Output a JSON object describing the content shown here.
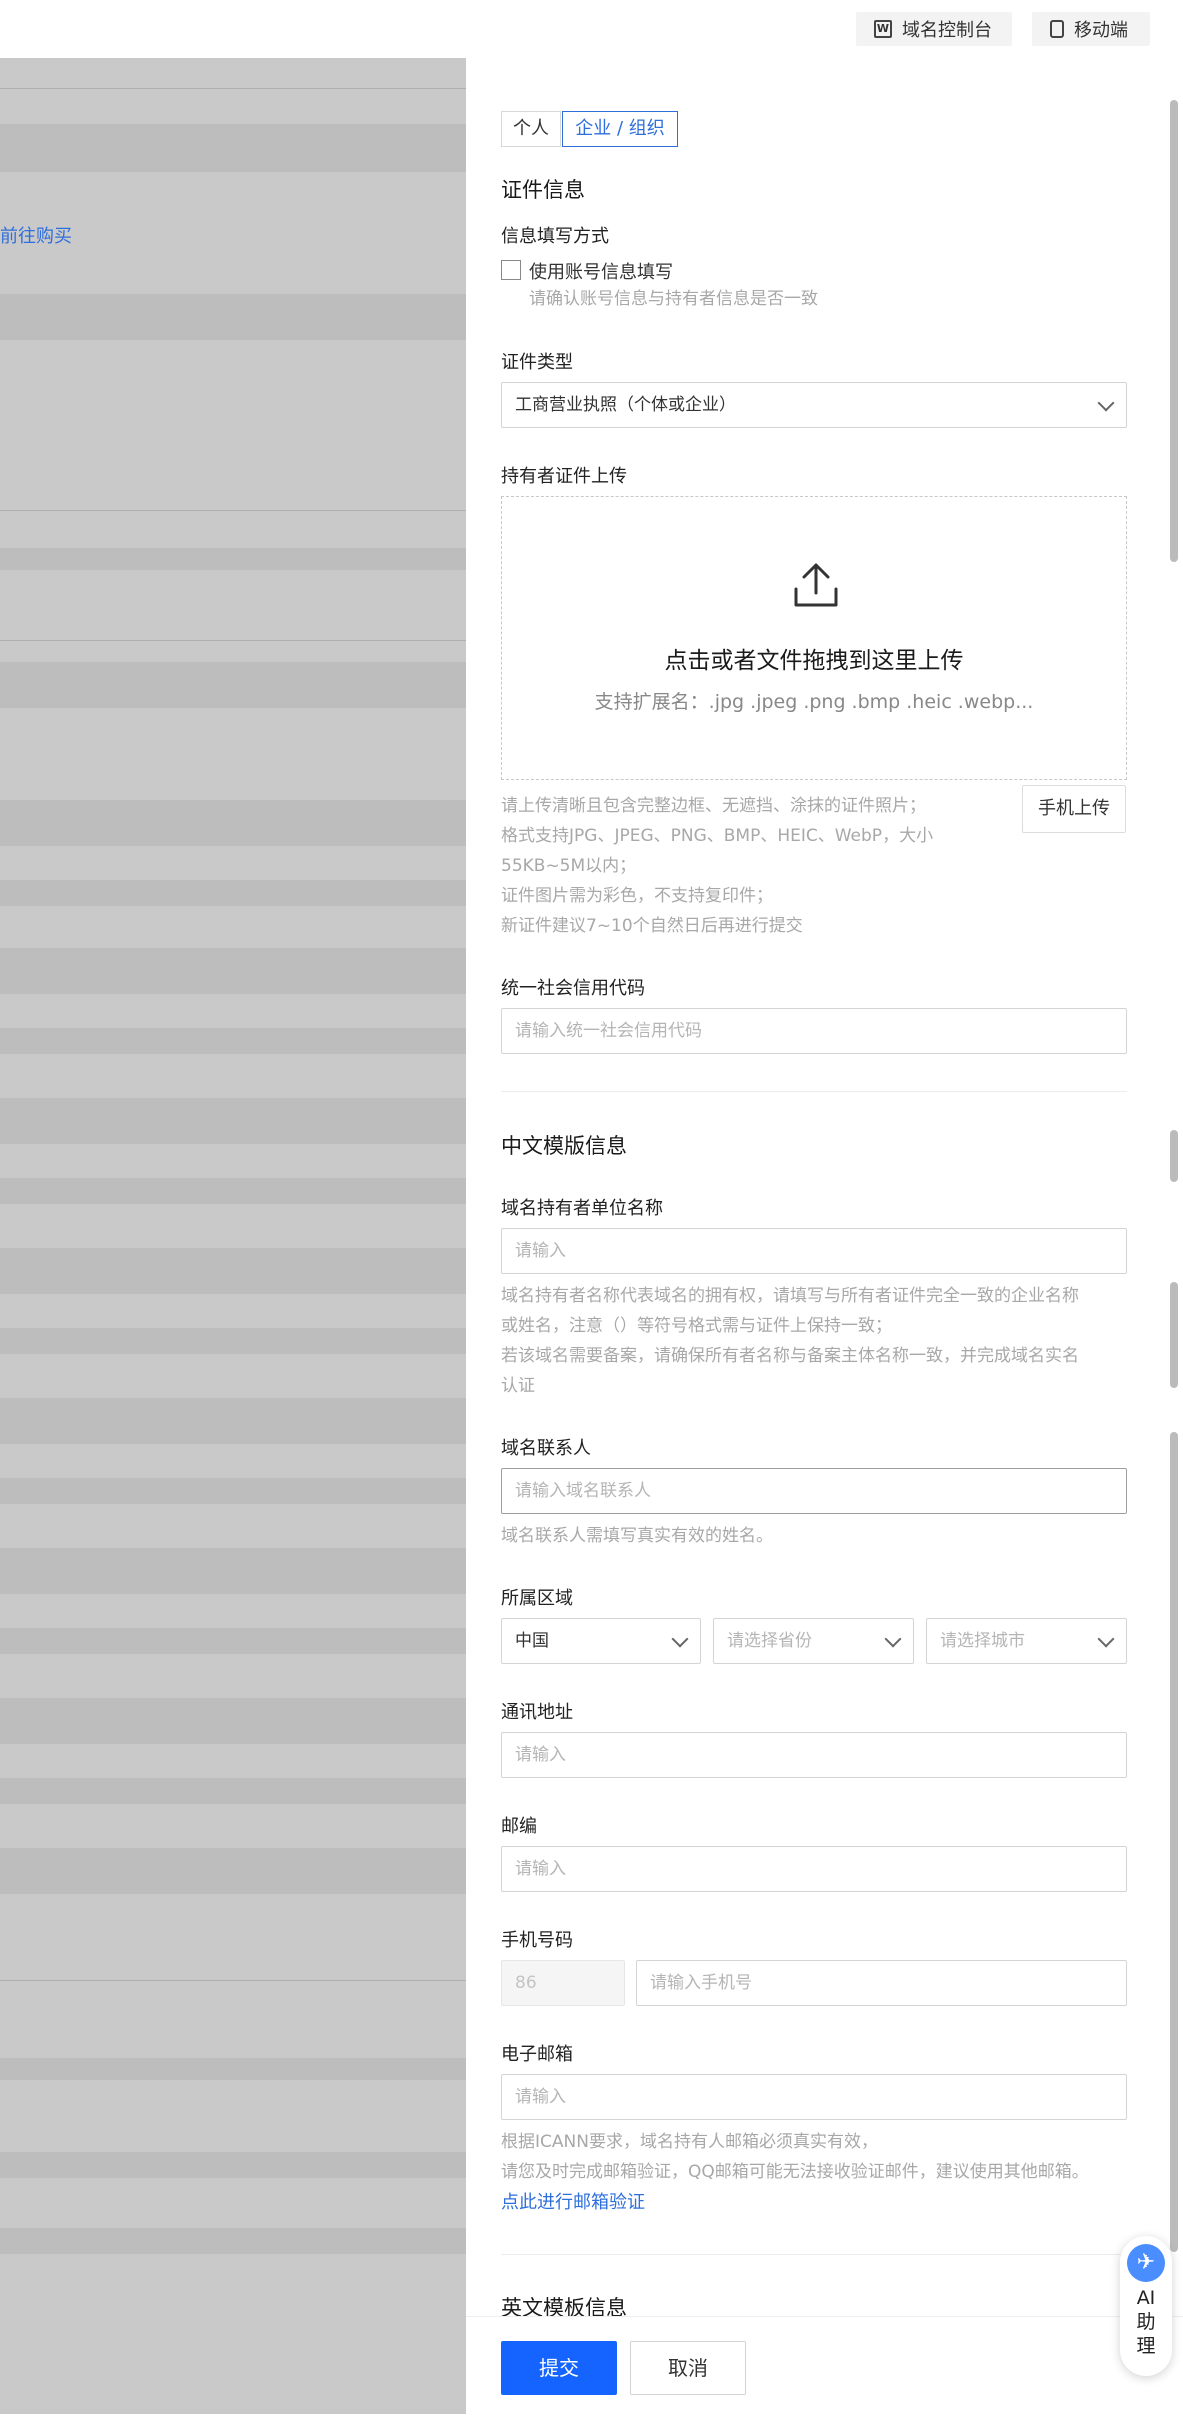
{
  "topbar": {
    "console_label": "域名控制台",
    "console_icon": "W",
    "mobile_label": "移动端"
  },
  "left": {
    "goto_label": "前往购买"
  },
  "tabs": {
    "personal": "个人",
    "enterprise": "企业 / 组织"
  },
  "cert_section": {
    "title": "证件信息",
    "fill_method_label": "信息填写方式",
    "use_account_label": "使用账号信息填写",
    "use_account_hint": "请确认账号信息与持有者信息是否一致",
    "cert_type_label": "证件类型",
    "cert_type_value": "工商营业执照（个体或企业）",
    "upload_label": "持有者证件上传",
    "upload_title": "点击或者文件拖拽到这里上传",
    "upload_ext": "支持扩展名：.jpg .jpeg .png .bmp .heic .webp...",
    "mobile_upload_label": "手机上传",
    "upload_hints": [
      "请上传清晰且包含完整边框、无遮挡、涂抹的证件照片；",
      "格式支持JPG、JPEG、PNG、BMP、HEIC、WebP，大小",
      "55KB~5M以内；",
      "证件图片需为彩色，不支持复印件；",
      "新证件建议7~10个自然日后再进行提交"
    ],
    "credit_code_label": "统一社会信用代码",
    "credit_code_placeholder": "请输入统一社会信用代码"
  },
  "cn_section": {
    "title": "中文模版信息",
    "holder_label": "域名持有者单位名称",
    "holder_placeholder": "请输入",
    "holder_hints": [
      "域名持有者名称代表域名的拥有权，请填写与所有者证件完全一致的企业名称",
      "或姓名，注意（）等符号格式需与证件上保持一致；",
      "若该域名需要备案，请确保所有者名称与备案主体名称一致，并完成域名实名",
      "认证"
    ],
    "contact_label": "域名联系人",
    "contact_placeholder": "请输入域名联系人",
    "contact_hint": "域名联系人需填写真实有效的姓名。",
    "region_label": "所属区域",
    "country_value": "中国",
    "province_placeholder": "请选择省份",
    "city_placeholder": "请选择城市",
    "address_label": "通讯地址",
    "address_placeholder": "请输入",
    "zip_label": "邮编",
    "zip_placeholder": "请输入",
    "phone_label": "手机号码",
    "phone_code": "86",
    "phone_placeholder": "请输入手机号",
    "email_label": "电子邮箱",
    "email_placeholder": "请输入",
    "email_hints": [
      "根据ICANN要求，域名持有人邮箱必须真实有效，",
      "请您及时完成邮箱验证，QQ邮箱可能无法接收验证邮件，建议使用其他邮箱。"
    ],
    "email_verify_link": "点此进行邮箱验证"
  },
  "en_section": {
    "title": "英文模板信息"
  },
  "footer": {
    "submit_label": "提交",
    "cancel_label": "取消"
  },
  "assistant": {
    "label": "AI助理",
    "icon": "✈"
  },
  "colors": {
    "primary": "#1664ff",
    "link": "#2f6fdc",
    "overlay": "#c9c9c9"
  }
}
